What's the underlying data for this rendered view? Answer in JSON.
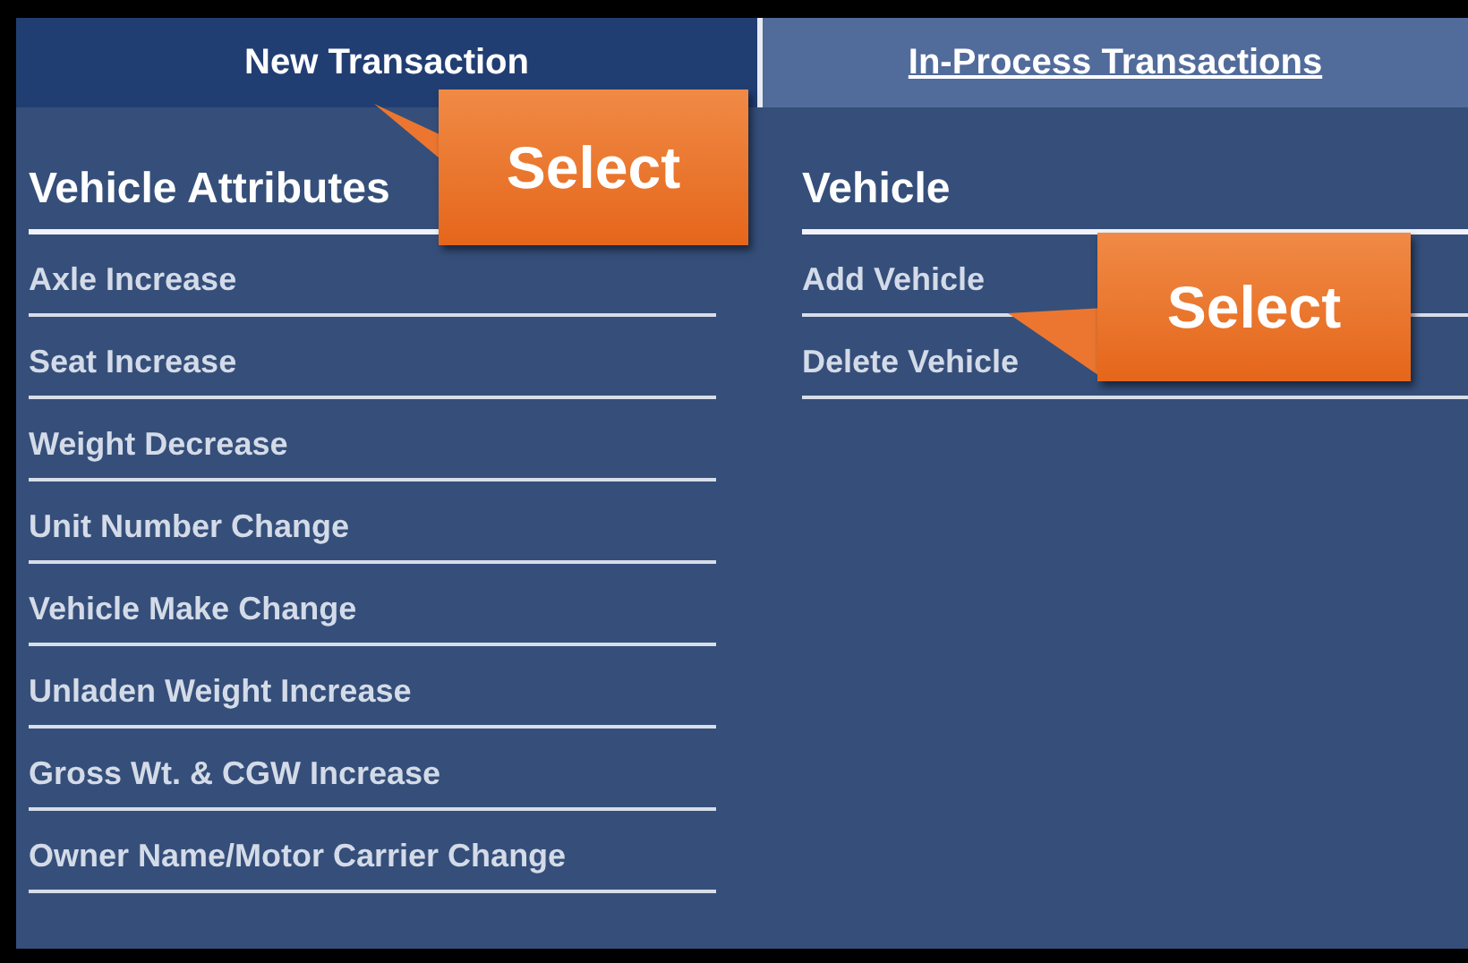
{
  "tabs": [
    {
      "label": "New Transaction",
      "selected": true
    },
    {
      "label": "In-Process Transactions",
      "selected": false
    }
  ],
  "sections": [
    {
      "title": "Vehicle Attributes",
      "items": [
        "Axle Increase",
        "Seat Increase",
        "Weight Decrease",
        "Unit Number Change",
        "Vehicle Make Change",
        "Unladen Weight Increase",
        "Gross Wt. & CGW Increase",
        "Owner Name/Motor Carrier Change"
      ]
    },
    {
      "title": "Vehicle",
      "items": [
        "Add Vehicle",
        "Delete Vehicle"
      ]
    }
  ],
  "callouts": [
    {
      "text": "Select"
    },
    {
      "text": "Select"
    }
  ]
}
